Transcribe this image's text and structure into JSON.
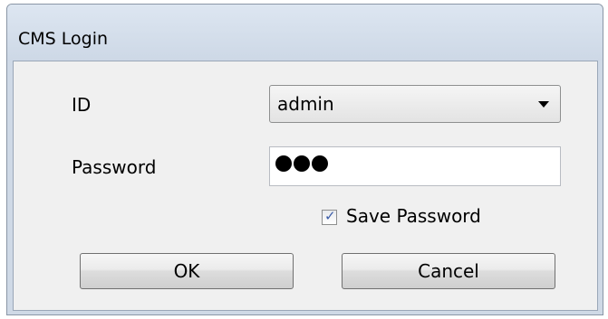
{
  "window": {
    "title": "CMS Login"
  },
  "form": {
    "id_label": "ID",
    "id_value": "admin",
    "password_label": "Password",
    "password_masked_count": 3,
    "save_password_label": "Save Password",
    "save_password_checked": true
  },
  "buttons": {
    "ok": "OK",
    "cancel": "Cancel"
  }
}
